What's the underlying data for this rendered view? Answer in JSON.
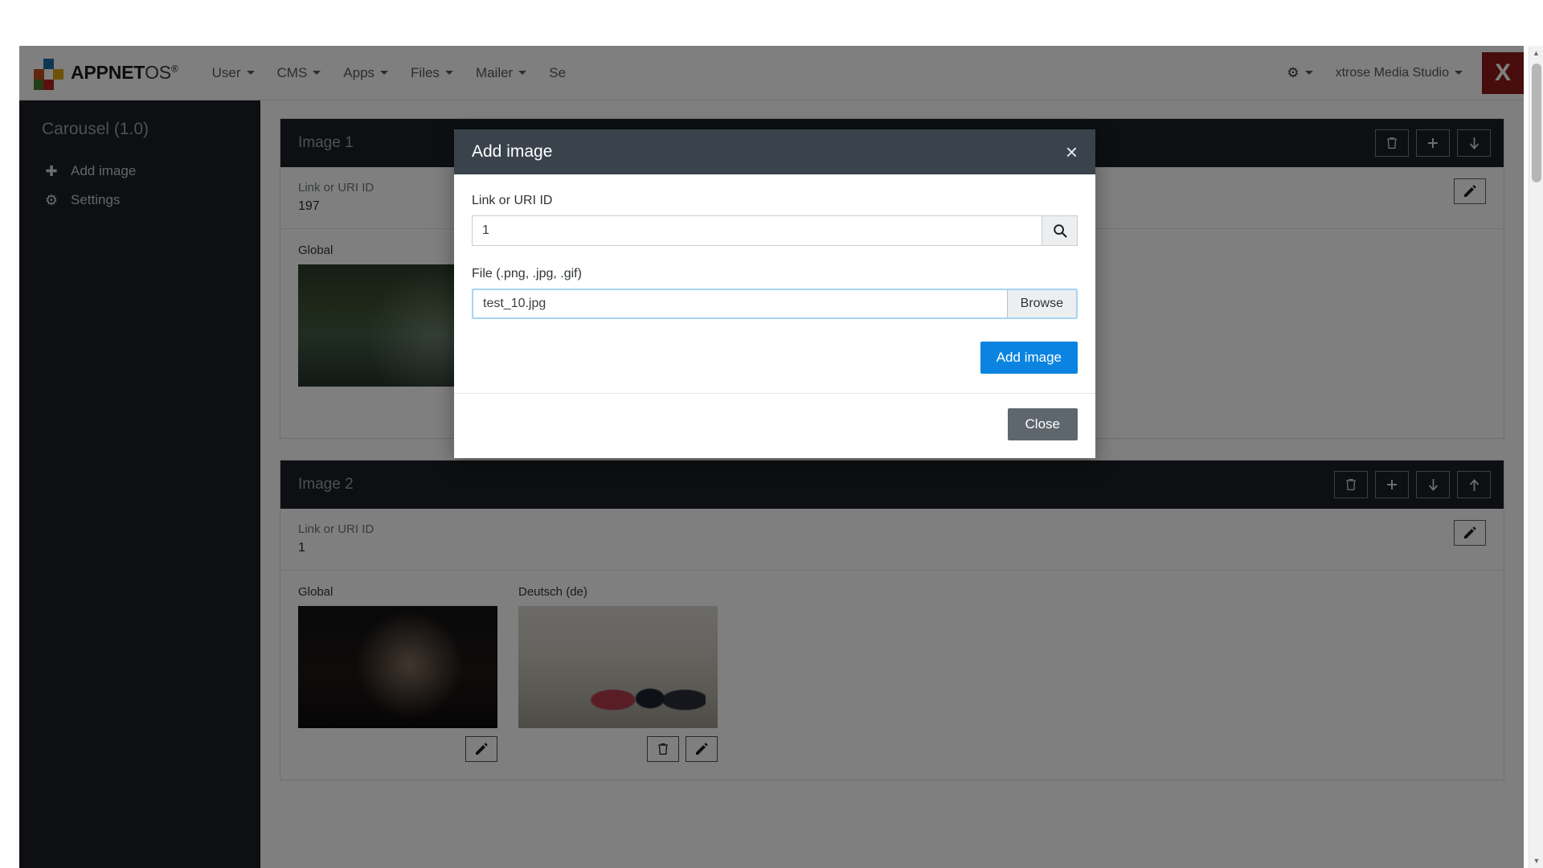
{
  "navbar": {
    "brand_bold": "APPNET",
    "brand_light": "OS",
    "brand_reg": "®",
    "items": [
      {
        "label": "User"
      },
      {
        "label": "CMS"
      },
      {
        "label": "Apps"
      },
      {
        "label": "Files"
      },
      {
        "label": "Mailer"
      },
      {
        "label": "Se"
      }
    ],
    "gear_icon": "gear-icon",
    "account_label": "xtrose Media Studio",
    "account_initial": "X",
    "brand_colors": {
      "blue": "#1f6ea8",
      "orange": "#c0501f",
      "yellow": "#d8a613",
      "green": "#4b7a2a",
      "red": "#b5231f",
      "badge": "#8e1b1b"
    }
  },
  "sidebar": {
    "title": "Carousel (1.0)",
    "items": [
      {
        "label": "Add image",
        "icon": "plus-icon",
        "glyph": "✚"
      },
      {
        "label": "Settings",
        "icon": "gear-icon",
        "glyph": "⚙"
      }
    ]
  },
  "panels": [
    {
      "title": "Image 1",
      "head_actions": [
        "trash-icon",
        "plus-icon",
        "arrow-down-icon"
      ],
      "link_label": "Link or URI ID",
      "link_value": "197",
      "thumbs": [
        {
          "label": "Global",
          "style": "ph-lake",
          "actions": [
            "edit-icon"
          ]
        },
        {
          "label": "",
          "style": "ph-hands",
          "actions": [
            "trash-icon",
            "edit-icon"
          ]
        },
        {
          "label": "",
          "style": "ph-dark",
          "actions": [
            "trash-icon",
            "edit-icon"
          ]
        }
      ]
    },
    {
      "title": "Image 2",
      "head_actions": [
        "trash-icon",
        "plus-icon",
        "arrow-down-icon",
        "arrow-up-icon"
      ],
      "link_label": "Link or URI ID",
      "link_value": "1",
      "thumbs": [
        {
          "label": "Global",
          "style": "ph-portrait",
          "actions": [
            "edit-icon"
          ]
        },
        {
          "label": "Deutsch (de)",
          "style": "ph-studio",
          "actions": [
            "trash-icon",
            "edit-icon"
          ]
        }
      ]
    }
  ],
  "modal": {
    "title": "Add image",
    "close_glyph": "×",
    "link_label": "Link or URI ID",
    "link_value": "1",
    "link_placeholder": "Link or URI ID",
    "search_icon": "search-icon",
    "file_label": "File (.png, .jpg, .gif)",
    "file_value": "test_10.jpg",
    "file_placeholder": "",
    "browse_label": "Browse",
    "submit_label": "Add image",
    "close_label": "Close",
    "accent_color": "#0a84e0",
    "header_color": "#3a434c"
  },
  "scrollbar": {
    "up_glyph": "▲",
    "down_glyph": "▼"
  }
}
